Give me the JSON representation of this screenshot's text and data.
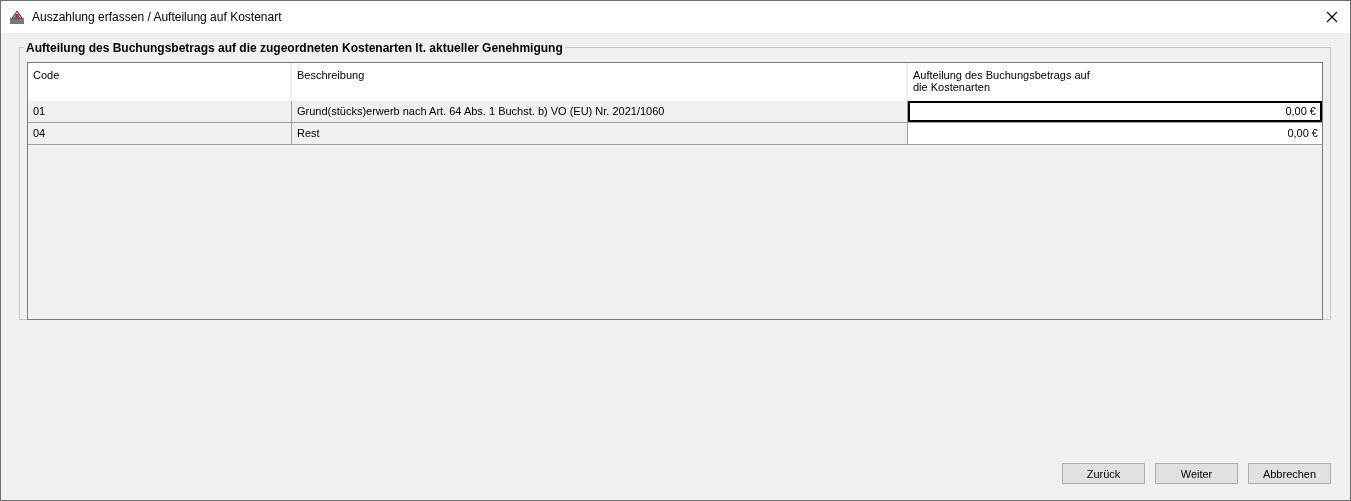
{
  "window": {
    "title": "Auszahlung erfassen / Aufteilung auf Kostenart"
  },
  "group": {
    "title": "Aufteilung des Buchungsbetrags auf die zugeordneten Kostenarten lt. aktueller Genehmigung"
  },
  "table": {
    "columns": [
      "Code",
      "Beschreibung",
      "Aufteilung des Buchungsbetrags auf die Kostenarten"
    ],
    "rows": [
      {
        "code": "01",
        "description": "Grund(stücks)erwerb nach Art. 64 Abs. 1 Buchst. b) VO (EU) Nr. 2021/1060",
        "amount": "0,00 €",
        "editing": true
      },
      {
        "code": "04",
        "description": "Rest",
        "amount": "0,00 €",
        "editing": false
      }
    ]
  },
  "buttons": [
    "Zurück",
    "Weiter",
    "Abbrechen"
  ]
}
